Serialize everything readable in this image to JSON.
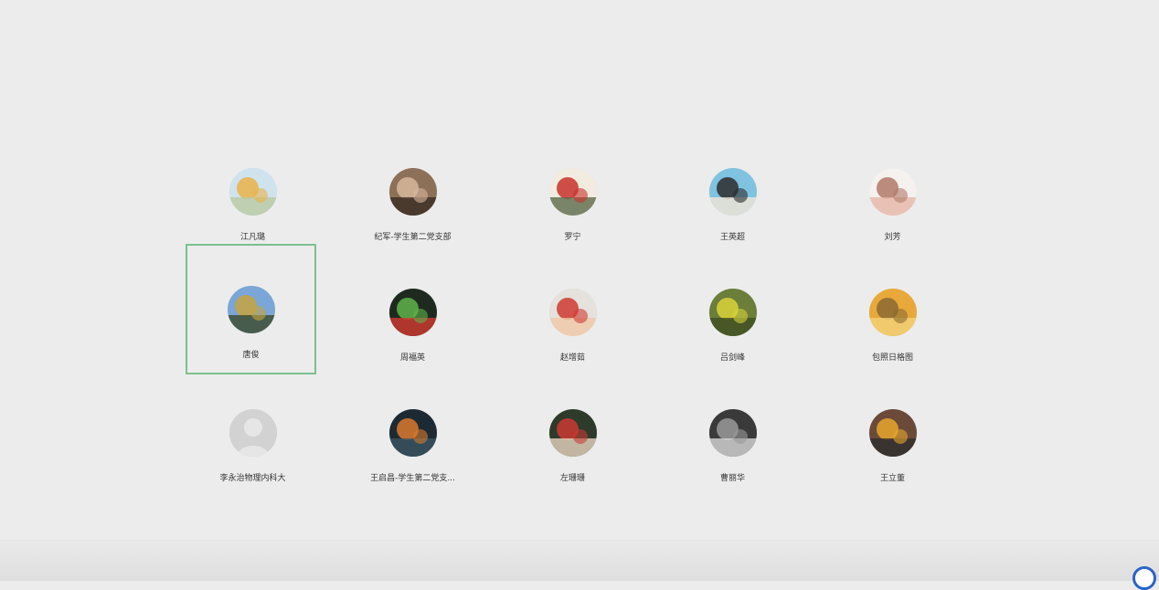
{
  "contacts": [
    {
      "name": "江凡璐",
      "avatar": "sunflower-girl-avatar",
      "colors": [
        "#cfe3ef",
        "#e9b34a",
        "#b9c9a2"
      ]
    },
    {
      "name": "纪军-学生第二党支部",
      "avatar": "man-portrait-avatar",
      "colors": [
        "#8c7058",
        "#d8b79c",
        "#3a2d24"
      ]
    },
    {
      "name": "罗宁",
      "avatar": "chinese-painting-avatar",
      "colors": [
        "#f2ece0",
        "#c8322c",
        "#5b6a4a"
      ]
    },
    {
      "name": "王英超",
      "avatar": "cartoon-photographer-avatar",
      "colors": [
        "#7fc3e0",
        "#2b2b2b",
        "#f3e6d6"
      ]
    },
    {
      "name": "刘芳",
      "avatar": "cartoon-bear-avatar",
      "colors": [
        "#f4f1ee",
        "#b07a6a",
        "#e7b7a6"
      ]
    },
    {
      "name": "唐俊",
      "avatar": "mountain-landscape-avatar",
      "colors": [
        "#7aa6d8",
        "#c7a33e",
        "#3c4a2a"
      ]
    },
    {
      "name": "周福英",
      "avatar": "green-plush-avatar",
      "colors": [
        "#1e2a20",
        "#5fb34a",
        "#d33a2f"
      ]
    },
    {
      "name": "赵增茹",
      "avatar": "child-photo-avatar",
      "colors": [
        "#e5e1dc",
        "#cf3a33",
        "#f0c8a8"
      ]
    },
    {
      "name": "吕剑峰",
      "avatar": "rapeseed-field-avatar",
      "colors": [
        "#6b7e3a",
        "#d9d23a",
        "#3f4d22"
      ]
    },
    {
      "name": "包照日格图",
      "avatar": "golden-horse-avatar",
      "colors": [
        "#e8a93a",
        "#8a6a32",
        "#f3d27a"
      ]
    },
    {
      "name": "李永治物理内科大",
      "avatar": "default-person-avatar",
      "colors": [
        "#d2d2d2",
        "#bdbdbd",
        "#e6e6e6"
      ]
    },
    {
      "name": "王启昌-学生第二党支...",
      "avatar": "tunnel-light-avatar",
      "colors": [
        "#1d2a33",
        "#d9792e",
        "#3a5562"
      ]
    },
    {
      "name": "左珊珊",
      "avatar": "red-flower-avatar",
      "colors": [
        "#2e3a2a",
        "#c93a33",
        "#e7d6c0"
      ]
    },
    {
      "name": "曹丽华",
      "avatar": "woman-bw-avatar",
      "colors": [
        "#3a3a3a",
        "#9a9a9a",
        "#d8d8d8"
      ]
    },
    {
      "name": "王立董",
      "avatar": "sunflower-bouquet-avatar",
      "colors": [
        "#6b4a3a",
        "#e6a62d",
        "#2e2e2e"
      ]
    }
  ],
  "selected_index": 5,
  "accent_color": "#7cc08f",
  "corner_button_icon": "browser-icon"
}
